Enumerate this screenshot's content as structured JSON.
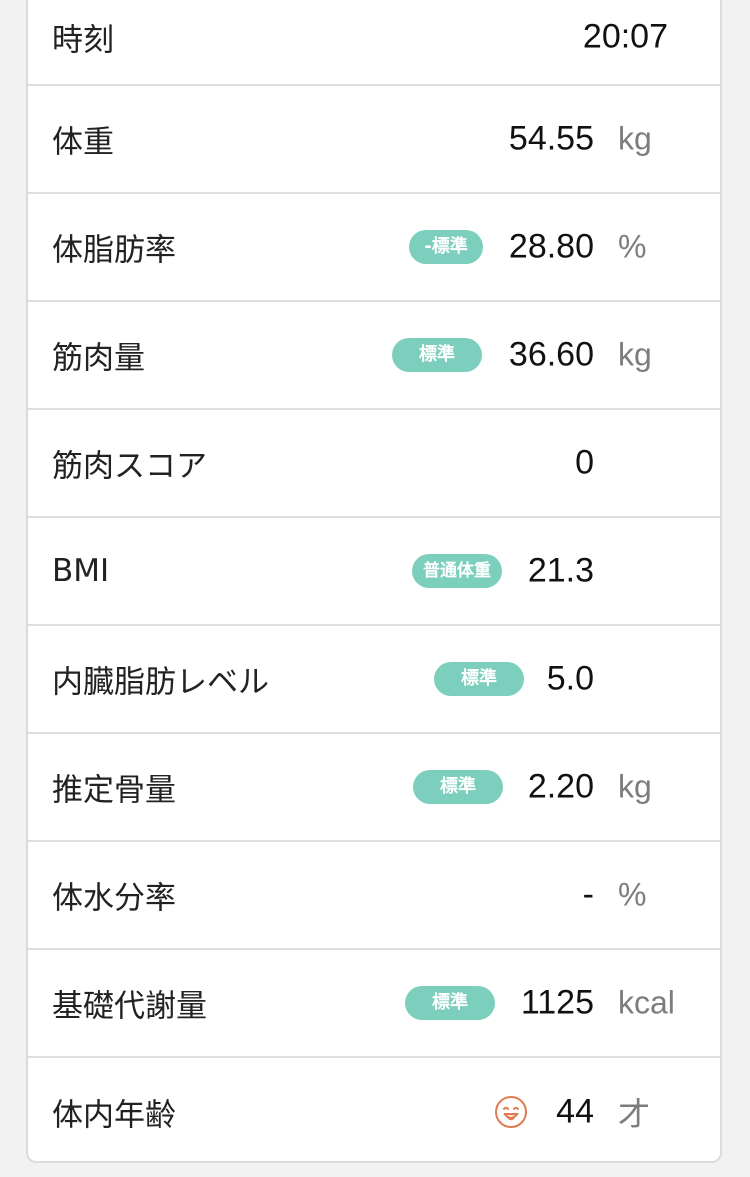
{
  "rows": [
    {
      "label": "時刻",
      "value": "20:07"
    },
    {
      "label": "体重",
      "value": "54.55",
      "unit": "kg"
    },
    {
      "label": "体脂肪率",
      "badge": "-標準",
      "value": "28.80",
      "unit": "%"
    },
    {
      "label": "筋肉量",
      "badge": "標準",
      "value": "36.60",
      "unit": "kg"
    },
    {
      "label": "筋肉スコア",
      "value": "0"
    },
    {
      "label": "BMI",
      "badge": "普通体重",
      "value": "21.3"
    },
    {
      "label": "内臓脂肪レベル",
      "badge": "標準",
      "value": "5.0"
    },
    {
      "label": "推定骨量",
      "badge": "標準",
      "value": "2.20",
      "unit": "kg"
    },
    {
      "label": "体水分率",
      "value": "-",
      "unit": "%"
    },
    {
      "label": "基礎代謝量",
      "badge": "標準",
      "value": "1125",
      "unit": "kcal"
    },
    {
      "label": "体内年齢",
      "icon": "smiling-face-icon",
      "value": "44",
      "unit": "才"
    }
  ],
  "colors": {
    "badge": "#7ccfbc",
    "face_icon": "#e07b4f",
    "unit_text": "#7d7d7d"
  }
}
